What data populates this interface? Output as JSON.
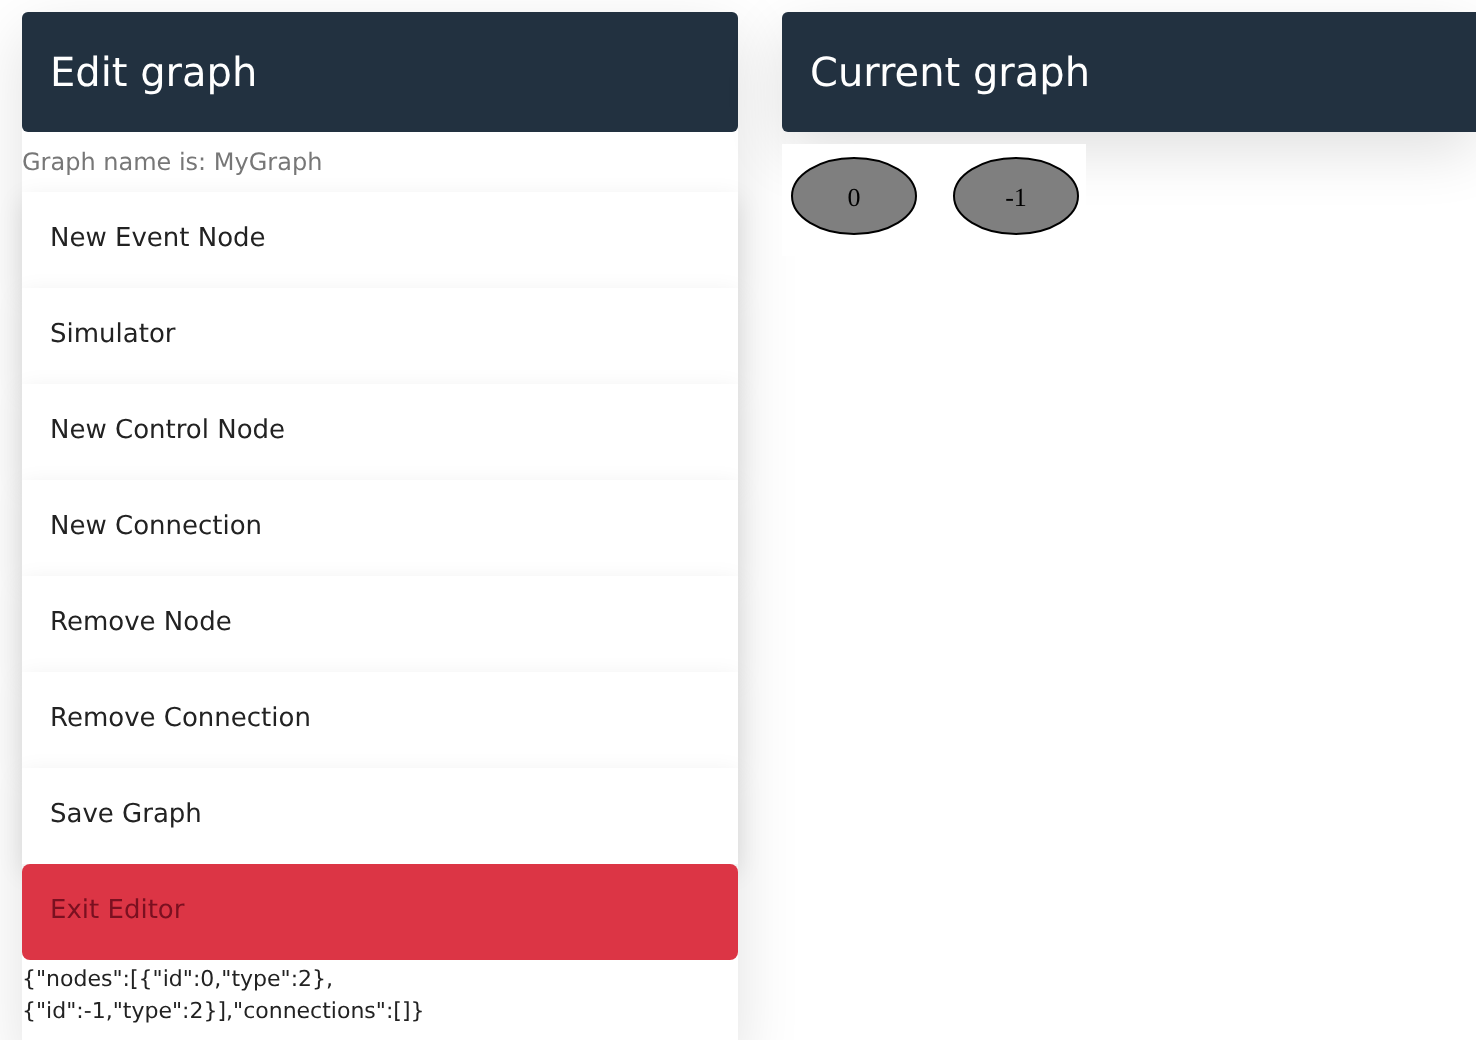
{
  "edit_panel": {
    "title": "Edit graph",
    "graph_name": "Graph name is: MyGraph",
    "buttons": [
      {
        "label": "New Event Node",
        "kind": "default"
      },
      {
        "label": "Simulator",
        "kind": "default"
      },
      {
        "label": "New Control Node",
        "kind": "default"
      },
      {
        "label": "New Connection",
        "kind": "default"
      },
      {
        "label": "Remove Node",
        "kind": "default"
      },
      {
        "label": "Remove Connection",
        "kind": "default"
      },
      {
        "label": "Save Graph",
        "kind": "default"
      },
      {
        "label": "Exit Editor",
        "kind": "danger"
      }
    ],
    "graph_json": "{\"nodes\":[{\"id\":0,\"type\":2},{\"id\":-1,\"type\":2}],\"connections\":[]}"
  },
  "graph_panel": {
    "title": "Current graph",
    "nodes": [
      {
        "label": "0"
      },
      {
        "label": "-1"
      }
    ]
  }
}
